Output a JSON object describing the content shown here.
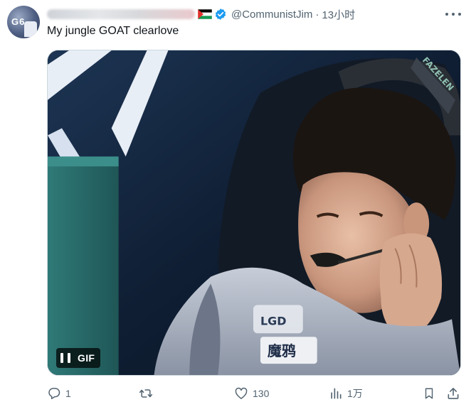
{
  "tweet": {
    "author": {
      "avatar_text": "G6",
      "verified": true,
      "handle": "@CommunistJim",
      "separator": "·",
      "timestamp": "13小时",
      "flag": "palestine-flag"
    },
    "text": "My jungle GOAT clearlove",
    "media": {
      "type": "gif",
      "badge_label": "GIF",
      "overlay_text": "FAZELEN",
      "control_state": "playing"
    },
    "actions": {
      "reply_count": "1",
      "retweet_count": "",
      "like_count": "130",
      "view_count": "1万"
    }
  },
  "colors": {
    "text_primary": "#0f1419",
    "text_secondary": "#536471",
    "verified_blue": "#1d9bf0",
    "border": "#cfd9de"
  }
}
